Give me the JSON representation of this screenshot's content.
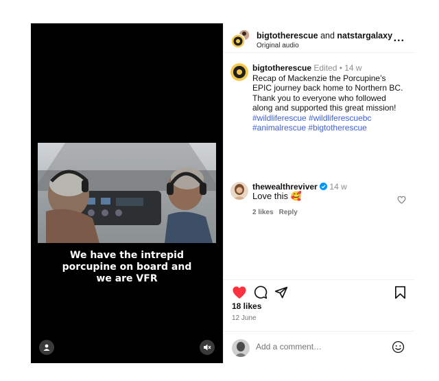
{
  "header": {
    "user1": "bigtotherescue",
    "joiner": " and ",
    "user2": "natstargalaxy",
    "audio": "Original audio",
    "more_label": "..."
  },
  "caption": {
    "username": "bigtotherescue",
    "edited": " Edited • 14 w",
    "text": "Recap of Mackenzie the Porcupine’s EPIC journey back home to Northern BC. Thank you to everyone who followed along and supported this great mission!",
    "hashtags": [
      "#wildliferescue",
      "#wildliferescuebc",
      "#animalrescue",
      "#bigtotherescue"
    ]
  },
  "comment": {
    "username": "thewealthreviver",
    "time": "14 w",
    "text": "Love this 🥰",
    "likes": "2 likes",
    "reply": "Reply"
  },
  "video": {
    "caption": "We have the intrepid\nporcupine on board and\nwe are VFR"
  },
  "actions": {
    "liked": true,
    "likes": "18 likes",
    "date": "12 June"
  },
  "add_comment": {
    "placeholder": "Add a comment…"
  },
  "colors": {
    "like_red": "#ff3040",
    "hashtag_blue": "#3d5fd6",
    "verified_blue": "#0095f6"
  },
  "icons": [
    "user-icon",
    "mute-icon",
    "more-icon",
    "heart-icon",
    "comment-icon",
    "share-icon",
    "bookmark-icon",
    "emoji-icon",
    "verified-icon"
  ]
}
